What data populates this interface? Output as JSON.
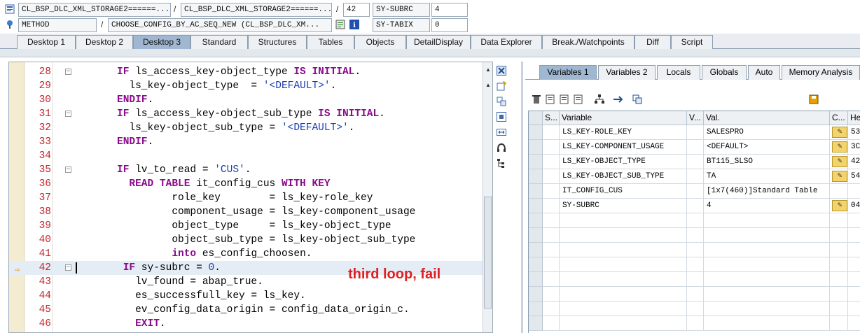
{
  "info_rows": {
    "row1": {
      "icon": "program-icon",
      "field1": "CL_BSP_DLC_XML_STORAGE2======...",
      "separator1": "/",
      "field2": "CL_BSP_DLC_XML_STORAGE2======...",
      "separator2": "/",
      "field3": "42",
      "sysvar_name": "SY-SUBRC",
      "sysvar_value": "4"
    },
    "row2": {
      "icon": "method-icon",
      "field1": "METHOD",
      "separator1": "/",
      "field2": "CHOOSE_CONFIG_BY_AC_SEQ_NEW (CL_BSP_DLC_XM...",
      "sysvar_name": "SY-TABIX",
      "sysvar_value": "0"
    }
  },
  "tabs": [
    {
      "label": "Desktop 1"
    },
    {
      "label": "Desktop 2"
    },
    {
      "label": "Desktop 3",
      "active": true
    },
    {
      "label": "Standard"
    },
    {
      "label": "Structures"
    },
    {
      "label": "Tables"
    },
    {
      "label": "Objects"
    },
    {
      "label": "DetailDisplay"
    },
    {
      "label": "Data Explorer"
    },
    {
      "label": "Break./Watchpoints"
    },
    {
      "label": "Diff"
    },
    {
      "label": "Script"
    }
  ],
  "editor": {
    "annotation": "third loop, fail",
    "current_line": "42",
    "lines": [
      {
        "no": "28",
        "text": "IF ls_access_key-object_type IS INITIAL."
      },
      {
        "no": "29",
        "text": "  ls_key-object_type  = '<DEFAULT>'."
      },
      {
        "no": "30",
        "text": "ENDIF."
      },
      {
        "no": "31",
        "text": "IF ls_access_key-object_sub_type IS INITIAL."
      },
      {
        "no": "32",
        "text": "  ls_key-object_sub_type = '<DEFAULT>'."
      },
      {
        "no": "33",
        "text": "ENDIF."
      },
      {
        "no": "34",
        "text": ""
      },
      {
        "no": "35",
        "text": "IF lv_to_read = 'CUS'."
      },
      {
        "no": "36",
        "text": "  READ TABLE it_config_cus WITH KEY"
      },
      {
        "no": "37",
        "text": "         role_key        = ls_key-role_key"
      },
      {
        "no": "38",
        "text": "         component_usage = ls_key-component_usage"
      },
      {
        "no": "39",
        "text": "         object_type     = ls_key-object_type"
      },
      {
        "no": "40",
        "text": "         object_sub_type = ls_key-object_sub_type"
      },
      {
        "no": "41",
        "text": "         into es_config_choosen."
      },
      {
        "no": "42",
        "text": " IF sy-subrc = 0."
      },
      {
        "no": "43",
        "text": "   lv_found = abap_true."
      },
      {
        "no": "44",
        "text": "   es_successfull_key = ls_key."
      },
      {
        "no": "45",
        "text": "   ev_config_data_origin = config_data_origin_c."
      },
      {
        "no": "46",
        "text": "   EXIT."
      }
    ]
  },
  "right_tabs": [
    {
      "label": "Variables 1",
      "active": true
    },
    {
      "label": "Variables 2"
    },
    {
      "label": "Locals"
    },
    {
      "label": "Globals"
    },
    {
      "label": "Auto"
    },
    {
      "label": "Memory Analysis"
    }
  ],
  "variables_table": {
    "columns": [
      "S...",
      "Variable",
      "V...",
      "Val.",
      "C...",
      "He"
    ],
    "rows": [
      {
        "variable": "LS_KEY-ROLE_KEY",
        "value": "SALESPRO",
        "hex": "53("
      },
      {
        "variable": "LS_KEY-COMPONENT_USAGE",
        "value": "<DEFAULT>",
        "hex": "3C("
      },
      {
        "variable": "LS_KEY-OBJECT_TYPE",
        "value": "BT115_SLSO",
        "hex": "42("
      },
      {
        "variable": "LS_KEY-OBJECT_SUB_TYPE",
        "value": "TA",
        "hex": "54("
      },
      {
        "variable": "IT_CONFIG_CUS",
        "value": "[1x7(460)]Standard Table",
        "hex": ""
      },
      {
        "variable": "SY-SUBRC",
        "value": "4",
        "hex": "04("
      }
    ]
  }
}
